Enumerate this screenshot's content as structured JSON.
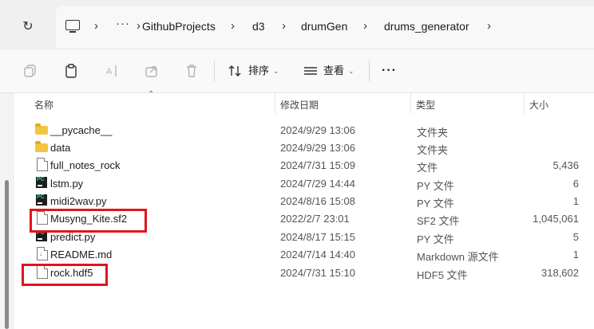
{
  "breadcrumb": {
    "overflow": "···",
    "items": [
      "GithubProjects",
      "d3",
      "drumGen",
      "drums_generator"
    ]
  },
  "toolbar": {
    "sort_label": "排序",
    "view_label": "查看",
    "more": "···"
  },
  "columns": {
    "name": "名称",
    "modified": "修改日期",
    "type": "类型",
    "size": "大小"
  },
  "files": [
    {
      "name": "__pycache__",
      "modified": "2024/9/29 13:06",
      "type": "文件夹",
      "size": "",
      "icon": "folder-icon"
    },
    {
      "name": "data",
      "modified": "2024/9/29 13:06",
      "type": "文件夹",
      "size": "",
      "icon": "folder-icon"
    },
    {
      "name": "full_notes_rock",
      "modified": "2024/7/31 15:09",
      "type": "文件",
      "size": "5,436",
      "icon": "file-icon"
    },
    {
      "name": "lstm.py",
      "modified": "2024/7/29 14:44",
      "type": "PY 文件",
      "size": "6",
      "icon": "python-file-icon"
    },
    {
      "name": "midi2wav.py",
      "modified": "2024/8/16 15:08",
      "type": "PY 文件",
      "size": "1",
      "icon": "python-file-icon"
    },
    {
      "name": "Musyng_Kite.sf2",
      "modified": "2022/2/7 23:01",
      "type": "SF2 文件",
      "size": "1,045,061",
      "icon": "file-icon"
    },
    {
      "name": "predict.py",
      "modified": "2024/8/17 15:15",
      "type": "PY 文件",
      "size": "5",
      "icon": "python-file-icon"
    },
    {
      "name": "README.md",
      "modified": "2024/7/14 14:40",
      "type": "Markdown 源文件",
      "size": "1",
      "icon": "markdown-file-icon"
    },
    {
      "name": "rock.hdf5",
      "modified": "2024/7/31 15:10",
      "type": "HDF5 文件",
      "size": "318,602",
      "icon": "file-icon"
    }
  ],
  "colors": {
    "highlight": "#e0141d",
    "folder": "#f4c542"
  }
}
